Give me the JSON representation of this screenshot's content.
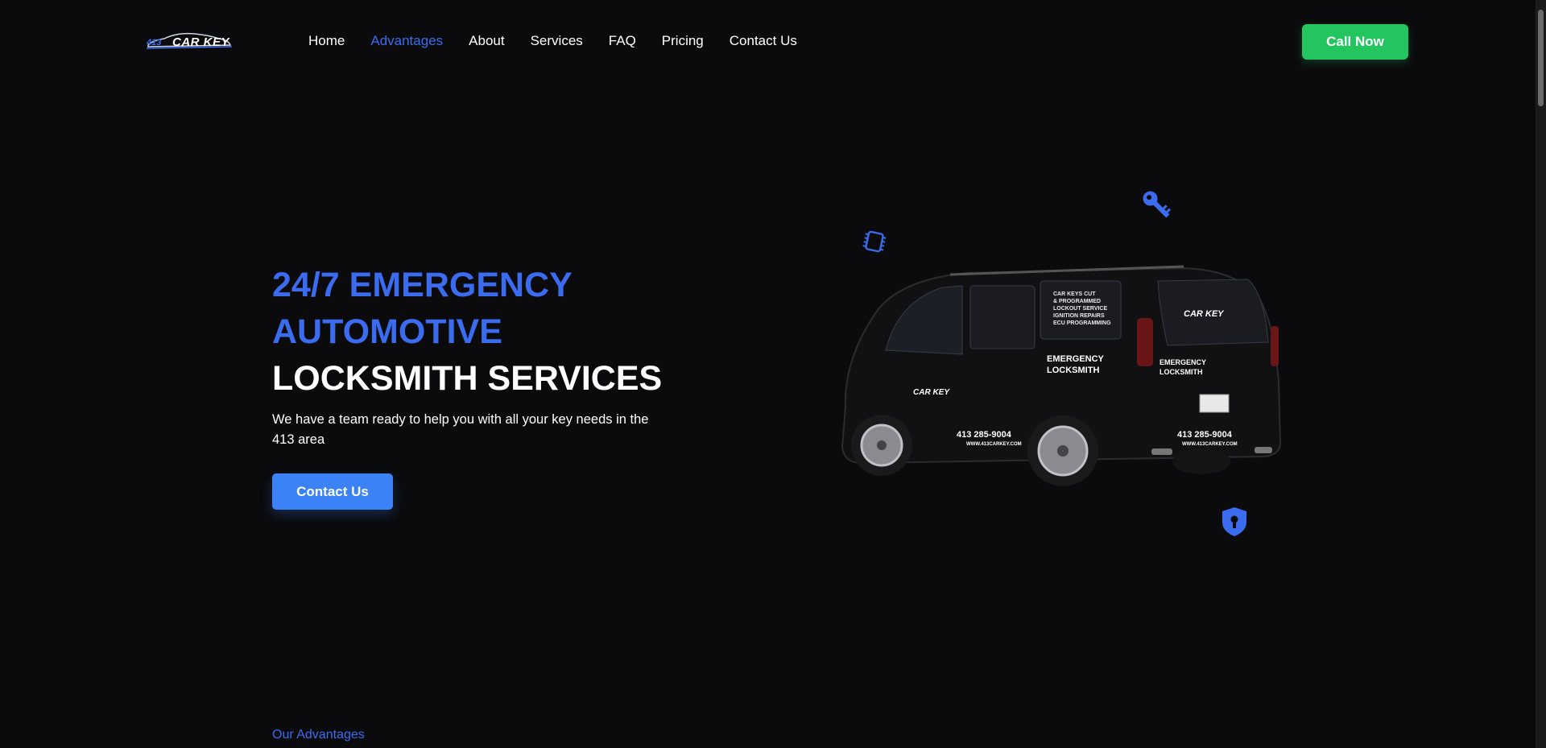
{
  "header": {
    "logo_text": "CAR KEY",
    "logo_badge": "413",
    "nav": [
      {
        "label": "Home",
        "active": false
      },
      {
        "label": "Advantages",
        "active": true
      },
      {
        "label": "About",
        "active": false
      },
      {
        "label": "Services",
        "active": false
      },
      {
        "label": "FAQ",
        "active": false
      },
      {
        "label": "Pricing",
        "active": false
      },
      {
        "label": "Contact Us",
        "active": false
      }
    ],
    "call_button": "Call Now"
  },
  "hero": {
    "title_line1": "24/7 EMERGENCY",
    "title_line2": "AUTOMOTIVE",
    "title_line3": "LOCKSMITH SERVICES",
    "subtitle": "We have a team ready to help you with all your key needs in the 413 area",
    "contact_button": "Contact Us"
  },
  "van": {
    "window_list": [
      "CAR KEYS CUT",
      "& PROGRAMMED",
      "LOCKOUT SERVICE",
      "IGNITION REPAIRS",
      "ECU PROGRAMMING"
    ],
    "side_text_1": "EMERGENCY",
    "side_text_2": "LOCKSMITH",
    "phone": "413 285-9004",
    "website": "WWW.413CARKEY.COM",
    "brand": "CAR KEY"
  },
  "icons": [
    "chip-icon",
    "key-icon",
    "shield-lock-icon"
  ],
  "advantages": {
    "label": "Our Advantages"
  },
  "colors": {
    "background": "#0b0b0e",
    "accent_blue": "#3b6cf0",
    "button_blue": "#3b82f6",
    "call_green": "#22c55e"
  }
}
